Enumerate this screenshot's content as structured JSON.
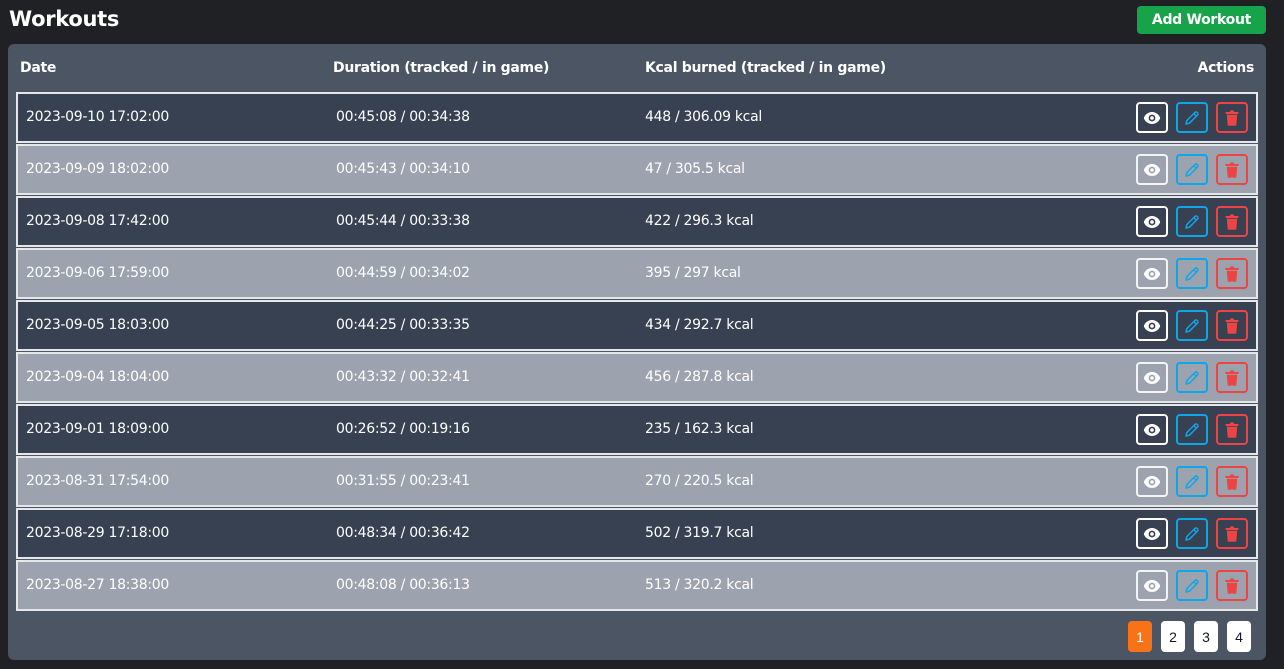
{
  "header": {
    "title": "Workouts",
    "add_label": "Add Workout"
  },
  "table": {
    "columns": {
      "date": "Date",
      "duration": "Duration (tracked / in game)",
      "kcal": "Kcal burned (tracked / in game)",
      "actions": "Actions"
    },
    "rows": [
      {
        "date": "2023-09-10 17:02:00",
        "duration": "00:45:08 / 00:34:38",
        "kcal": "448 / 306.09 kcal"
      },
      {
        "date": "2023-09-09 18:02:00",
        "duration": "00:45:43 / 00:34:10",
        "kcal": "47 / 305.5 kcal"
      },
      {
        "date": "2023-09-08 17:42:00",
        "duration": "00:45:44 / 00:33:38",
        "kcal": "422 / 296.3 kcal"
      },
      {
        "date": "2023-09-06 17:59:00",
        "duration": "00:44:59 / 00:34:02",
        "kcal": "395 / 297 kcal"
      },
      {
        "date": "2023-09-05 18:03:00",
        "duration": "00:44:25 / 00:33:35",
        "kcal": "434 / 292.7 kcal"
      },
      {
        "date": "2023-09-04 18:04:00",
        "duration": "00:43:32 / 00:32:41",
        "kcal": "456 / 287.8 kcal"
      },
      {
        "date": "2023-09-01 18:09:00",
        "duration": "00:26:52 / 00:19:16",
        "kcal": "235 / 162.3 kcal"
      },
      {
        "date": "2023-08-31 17:54:00",
        "duration": "00:31:55 / 00:23:41",
        "kcal": "270 / 220.5 kcal"
      },
      {
        "date": "2023-08-29 17:18:00",
        "duration": "00:48:34 / 00:36:42",
        "kcal": "502 / 319.7 kcal"
      },
      {
        "date": "2023-08-27 18:38:00",
        "duration": "00:48:08 / 00:36:13",
        "kcal": "513 / 320.2 kcal"
      }
    ],
    "row_actions": [
      "eye-icon",
      "pencil-icon",
      "trash-icon"
    ]
  },
  "pagination": {
    "pages": [
      "1",
      "2",
      "3",
      "4"
    ],
    "current": "1"
  },
  "colors": {
    "background": "#202124",
    "card": "#4b5563",
    "row_dark": "#374151",
    "row_light": "#9ca3af",
    "add_button": "#16a34a",
    "edit_accent": "#0ea5e9",
    "delete_accent": "#ef4444",
    "active_page": "#f97316"
  }
}
